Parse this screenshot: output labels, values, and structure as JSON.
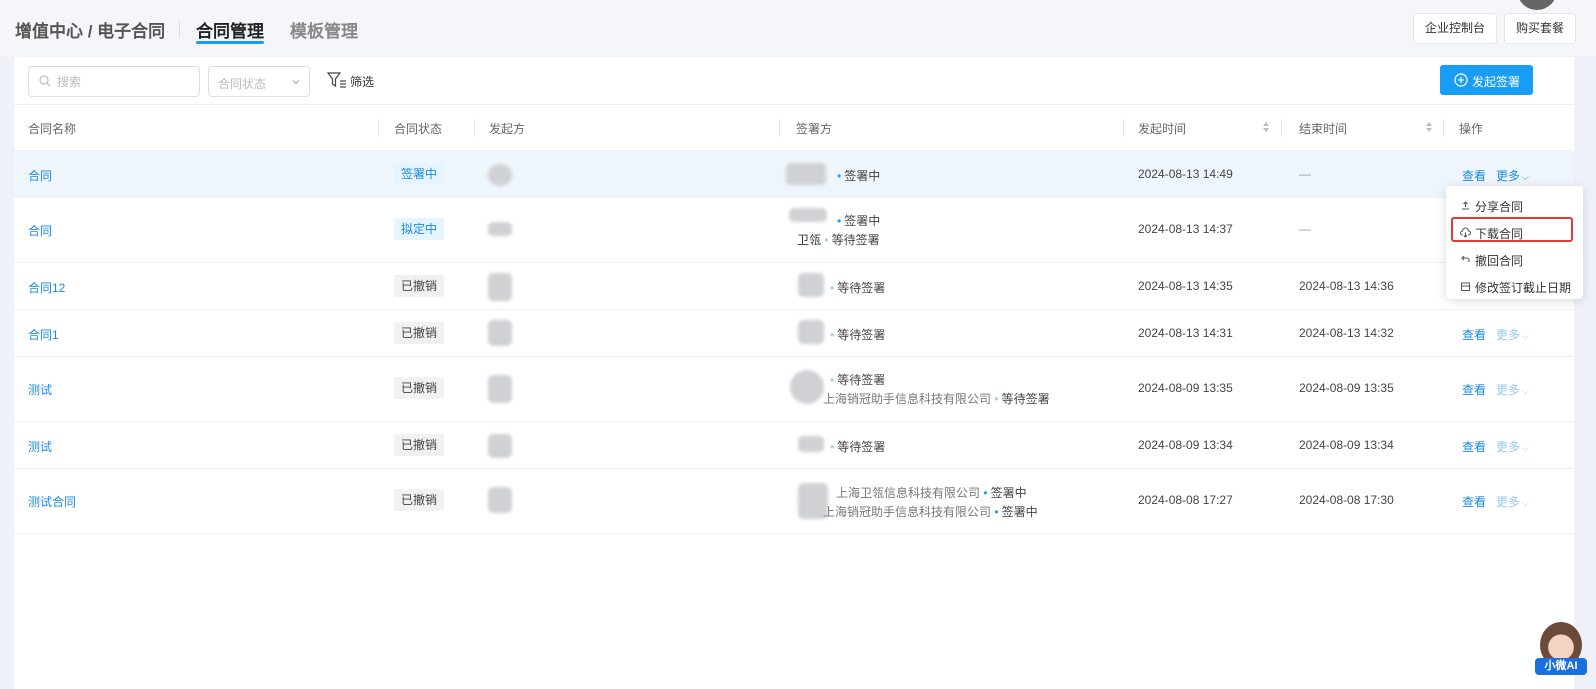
{
  "header": {
    "breadcrumb": "增值中心 / 电子合同",
    "tabs": [
      {
        "label": "合同管理",
        "active": true
      },
      {
        "label": "模板管理",
        "active": false
      }
    ],
    "buttons": {
      "console": "企业控制台",
      "buy": "购买套餐"
    }
  },
  "toolbar": {
    "search_placeholder": "搜索",
    "status_select": "合同状态",
    "filter_label": "筛选",
    "start_sign": "发起签署"
  },
  "table": {
    "columns": [
      "合同名称",
      "合同状态",
      "发起方",
      "签署方",
      "发起时间",
      "结束时间",
      "操作"
    ],
    "rows": [
      {
        "name": "合同",
        "status": "签署中",
        "signers": [
          {
            "company": "",
            "state": "签署中"
          }
        ],
        "start": "2024-08-13 14:49",
        "end": "—",
        "view": "查看",
        "more": "更多"
      },
      {
        "name": "合同",
        "status": "拟定中",
        "signers": [
          {
            "company": "",
            "state": "签署中"
          },
          {
            "company": "卫瓴",
            "state": "等待签署"
          }
        ],
        "start": "2024-08-13 14:37",
        "end": "—"
      },
      {
        "name": "合同12",
        "status": "已撤销",
        "signers": [
          {
            "company": "",
            "state": "等待签署"
          }
        ],
        "start": "2024-08-13 14:35",
        "end": "2024-08-13 14:36"
      },
      {
        "name": "合同1",
        "status": "已撤销",
        "signers": [
          {
            "company": "",
            "state": "等待签署"
          }
        ],
        "start": "2024-08-13 14:31",
        "end": "2024-08-13 14:32",
        "view": "查看",
        "more": "更多"
      },
      {
        "name": "测试",
        "status": "已撤销",
        "signers": [
          {
            "company": "",
            "state": "等待签署"
          },
          {
            "company": "上海销冠助手信息科技有限公司",
            "state": "等待签署"
          }
        ],
        "start": "2024-08-09 13:35",
        "end": "2024-08-09 13:35",
        "view": "查看",
        "more": "更多"
      },
      {
        "name": "测试",
        "status": "已撤销",
        "signers": [
          {
            "company": "",
            "state": "等待签署"
          }
        ],
        "start": "2024-08-09 13:34",
        "end": "2024-08-09 13:34",
        "view": "查看",
        "more": "更多"
      },
      {
        "name": "测试合同",
        "status": "已撤销",
        "signers": [
          {
            "company": "上海卫瓴信息科技有限公司",
            "state": "签署中"
          },
          {
            "company": "上海销冠助手信息科技有限公司",
            "state": "签署中"
          }
        ],
        "start": "2024-08-08 17:27",
        "end": "2024-08-08 17:30",
        "view": "查看",
        "more": "更多"
      }
    ]
  },
  "dropdown": {
    "items": [
      "分享合同",
      "下载合同",
      "撤回合同",
      "修改签订截止日期"
    ],
    "highlighted": "下载合同"
  },
  "ai_widget": {
    "label": "小微AI"
  },
  "colors": {
    "primary": "#1a9df5",
    "link": "#1a8be6",
    "highlight_border": "#e53935"
  }
}
